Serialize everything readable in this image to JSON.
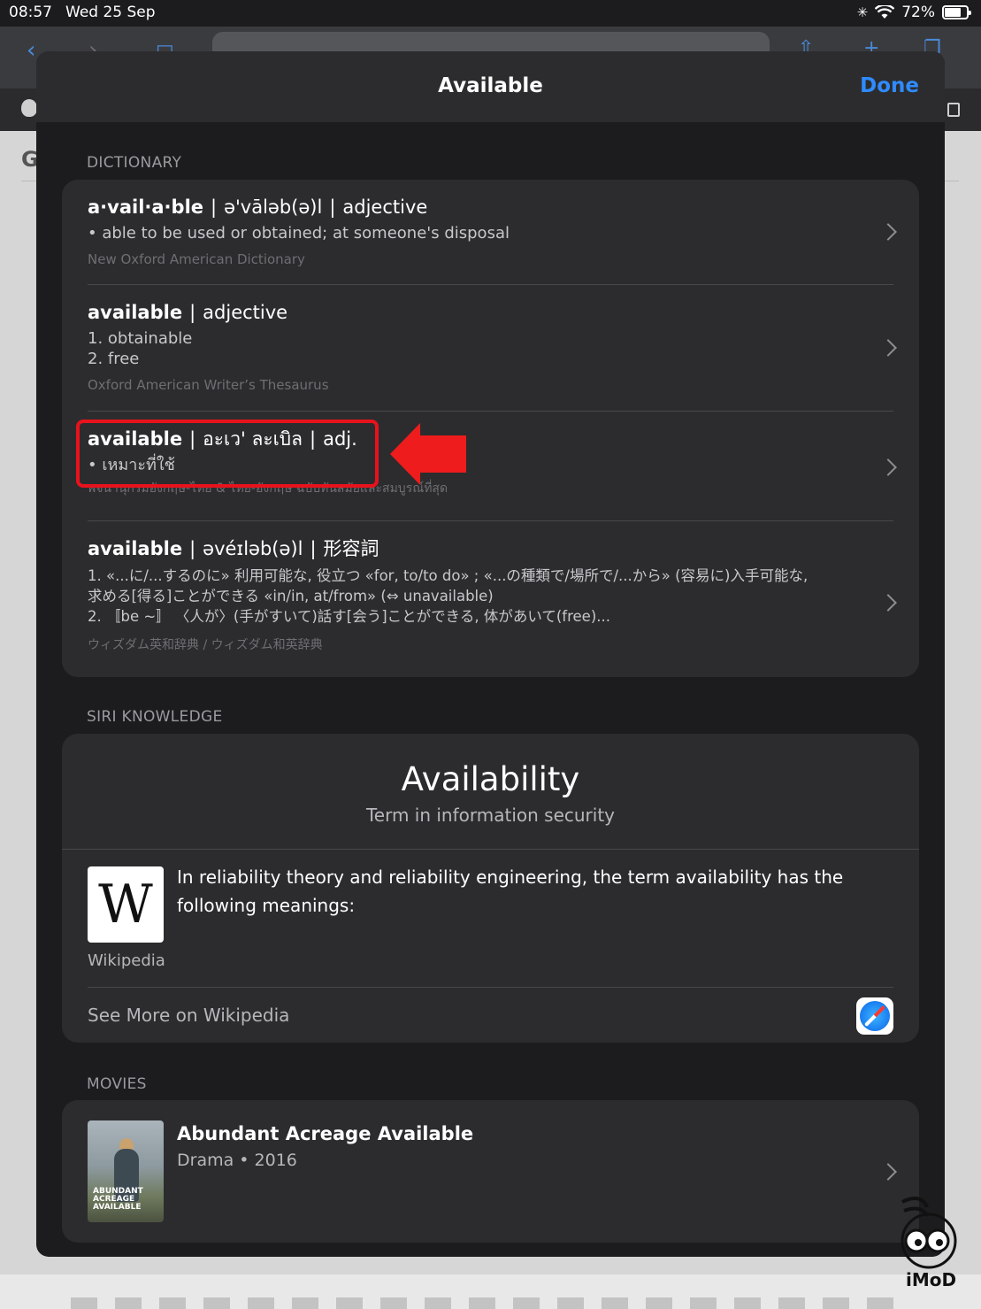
{
  "status_bar": {
    "time": "08:57",
    "date": "Wed 25 Sep",
    "battery": "72%"
  },
  "background_page": {
    "heading_fragment": "G"
  },
  "sheet": {
    "title": "Available",
    "done_label": "Done",
    "dictionary": {
      "section_label": "DICTIONARY",
      "entries": [
        {
          "word": "a·vail·a·ble",
          "parts": [
            "ə'vāləb(ə)l",
            "adjective"
          ],
          "defs": [
            "• able to be used or obtained; at someone's disposal"
          ],
          "source": "New Oxford American Dictionary"
        },
        {
          "word": "available",
          "parts": [
            "adjective"
          ],
          "defs": [
            "1. obtainable",
            "2. free"
          ],
          "source": "Oxford American Writer’s Thesaurus"
        },
        {
          "word": "available",
          "parts": [
            "อะเว' ละเบิล",
            "adj."
          ],
          "defs": [
            "• เหมาะที่ใช้"
          ],
          "source": "พจนานุกรมอังกฤษ-ไทย & ไทย-อังกฤษ ฉบับทันสมัยและสมบูรณ์ที่สุด"
        },
        {
          "word": "available",
          "parts": [
            "əvéɪləb(ə)l",
            "形容詞"
          ],
          "defs": [
            "1. «...に/...するのに» 利用可能な, 役立つ «for, to/to do» ; «...の種類で/場所で/...から» (容易に)入手可能な,",
            "求める[得る]ことができる «in/in, at/from» (⇔ unavailable)",
            "2. 〚be ~〛 〈人が〉(手がすいて)話す[会う]ことができる, 体があいて(free)..."
          ],
          "source": "ウィズダム英和辞典 / ウィズダム和英辞典"
        }
      ]
    },
    "siri_knowledge": {
      "section_label": "SIRI KNOWLEDGE",
      "title": "Availability",
      "subtitle": "Term in information security",
      "logo_letter": "W",
      "source_label": "Wikipedia",
      "text": "In reliability theory and reliability engineering, the term availability has the following meanings:",
      "see_more": "See More on Wikipedia"
    },
    "movies": {
      "section_label": "MOVIES",
      "items": [
        {
          "title": "Abundant Acreage Available",
          "meta": "Drama • 2016",
          "poster_text": "ABUNDANT ACREAGE AVAILABLE"
        }
      ]
    }
  },
  "watermark": {
    "text": "iMoD"
  },
  "colors": {
    "accent": "#2f8bff",
    "highlight": "#e8121c",
    "sheet_bg": "#1c1c1e",
    "card_bg": "#2c2c2e"
  }
}
